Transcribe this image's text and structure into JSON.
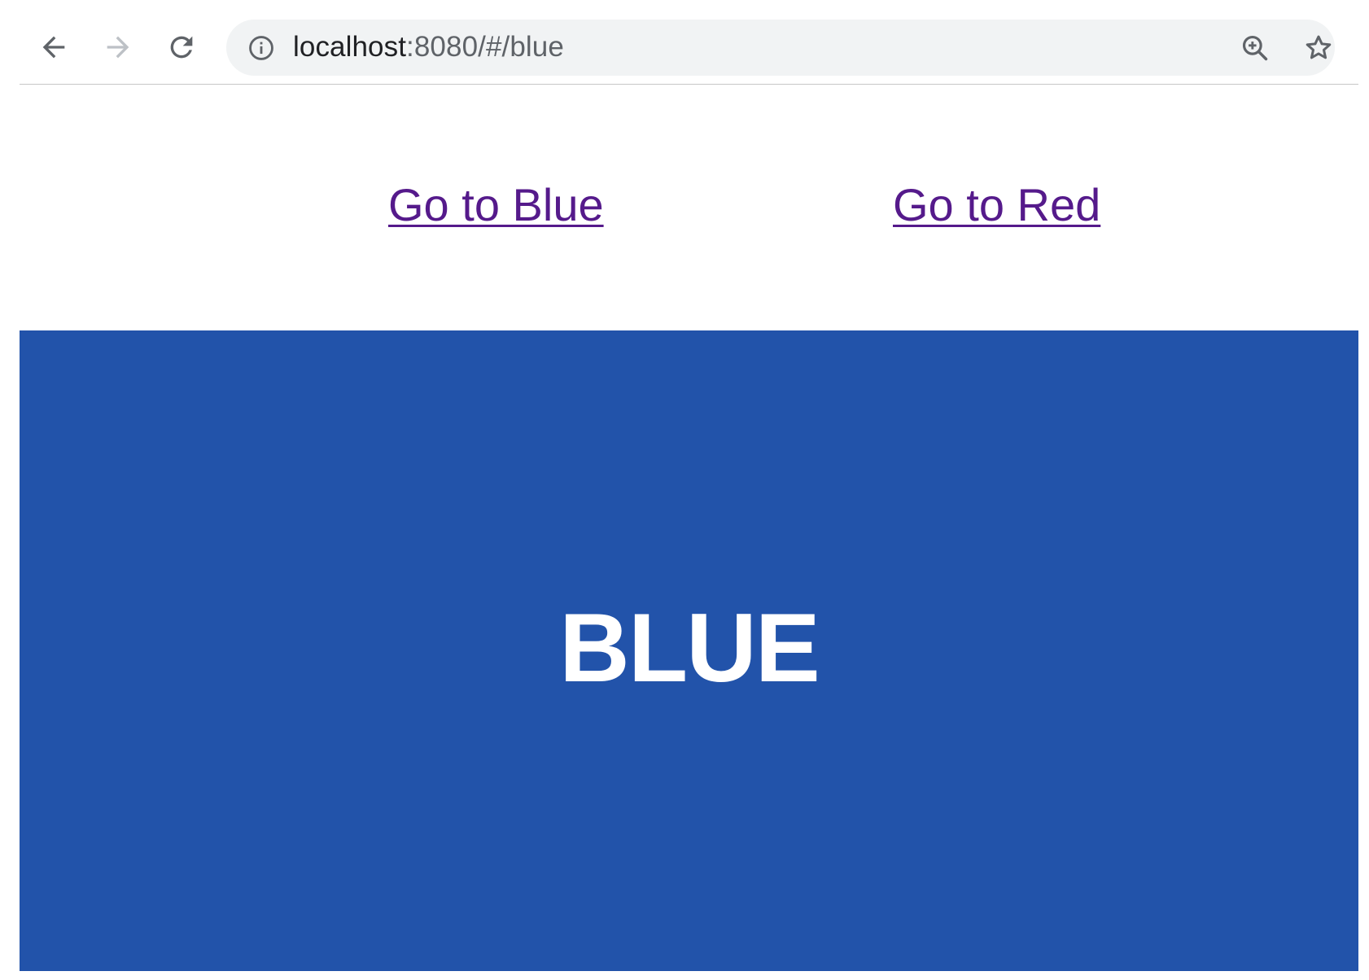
{
  "browser": {
    "url_host": "localhost",
    "url_rest": ":8080/#/blue",
    "icons": {
      "back": "arrow-left-icon",
      "forward": "arrow-right-icon",
      "reload": "reload-icon",
      "site_info": "info-icon",
      "zoom": "zoom-in-icon",
      "bookmark": "star-icon"
    },
    "forward_enabled": false
  },
  "links": {
    "blue": "Go to Blue",
    "red": "Go to Red",
    "visited_color": "#551a8b"
  },
  "panel": {
    "label": "BLUE",
    "background": "#2253aa",
    "text_color": "#ffffff"
  }
}
